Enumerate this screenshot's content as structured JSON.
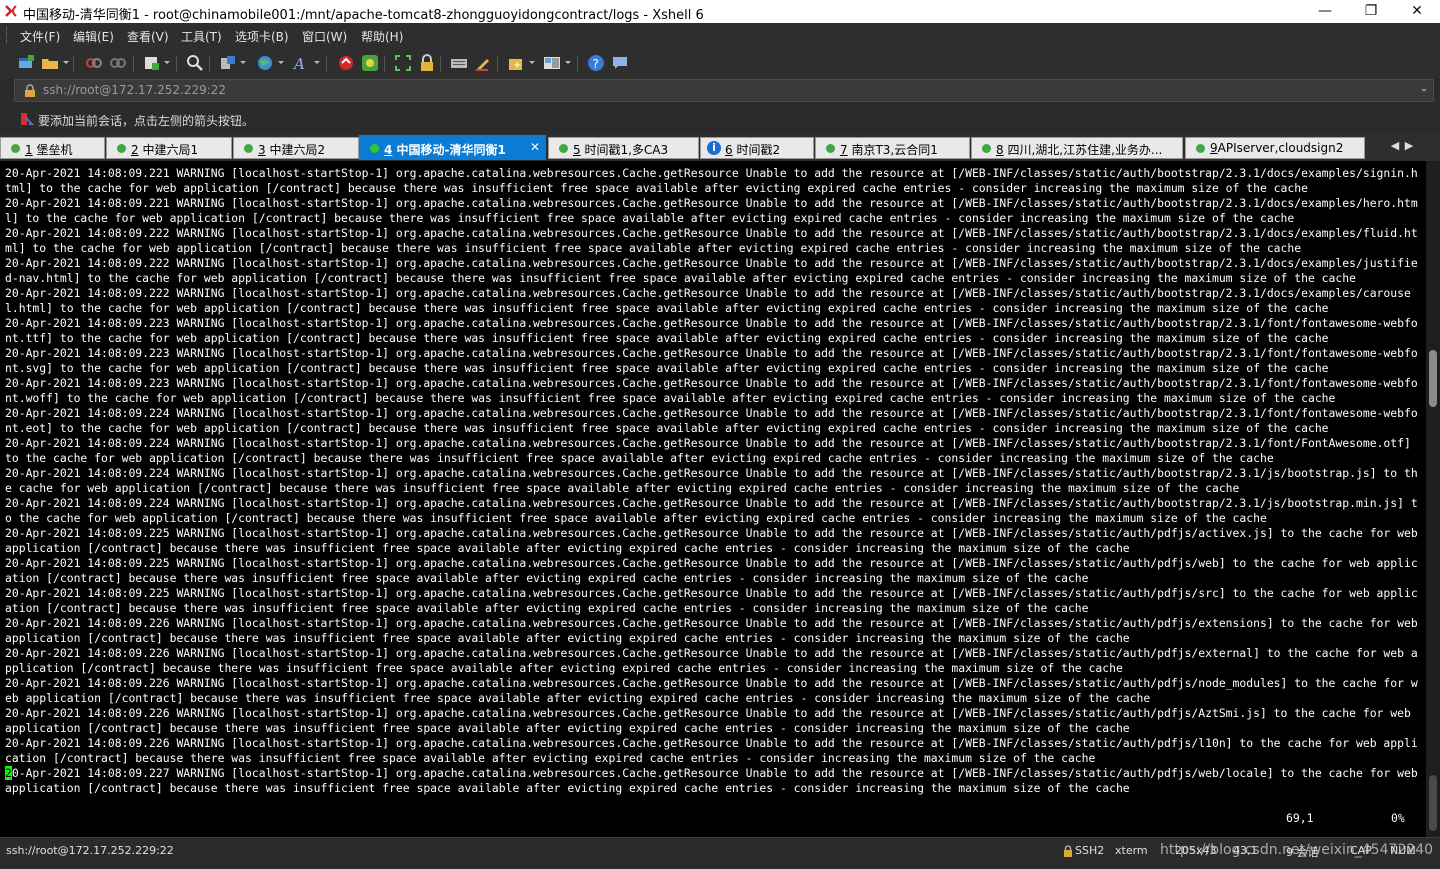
{
  "window": {
    "title": "中国移动-清华同衡1 - root@chinamobile001:/mnt/apache-tomcat8-zhongguoyidongcontract/logs - Xshell 6",
    "minimize": "—",
    "maximize": "❐",
    "close": "✕"
  },
  "menu": [
    "文件(F)",
    "编辑(E)",
    "查看(V)",
    "工具(T)",
    "选项卡(B)",
    "窗口(W)",
    "帮助(H)"
  ],
  "address": {
    "value": "ssh://root@172.17.252.229:22"
  },
  "hint": {
    "text": "要添加当前会话，点击左侧的箭头按钮。"
  },
  "tabs": [
    {
      "num": "1",
      "name": "堡垒机",
      "status": "connected"
    },
    {
      "num": "2",
      "name": "中建六局1",
      "status": "connected"
    },
    {
      "num": "3",
      "name": "中建六局2",
      "status": "connected"
    },
    {
      "num": "4",
      "name": "中国移动-清华同衡1",
      "status": "connected",
      "active": true,
      "close": "✕"
    },
    {
      "num": "5",
      "name": "时间戳1,多CA3",
      "status": "connected"
    },
    {
      "num": "6",
      "name": "时间戳2",
      "status": "info",
      "badge": "i"
    },
    {
      "num": "7",
      "name": "南京T3,云合同1",
      "status": "connected"
    },
    {
      "num": "8",
      "name": "四川,湖北,江苏住建,业务办...",
      "status": "connected"
    },
    {
      "num": "9",
      "name": "APIserver,cloudsign2",
      "status": "connected"
    }
  ],
  "tab_nav": {
    "prev": "◀",
    "next": "▶"
  },
  "terminal": {
    "lines": [
      "20-Apr-2021 14:08:09.221 WARNING [localhost-startStop-1] org.apache.catalina.webresources.Cache.getResource Unable to add the resource at [/WEB-INF/classes/static/auth/bootstrap/2.3.1/docs/examples/signin.html] to the cache for web application [/contract] because there was insufficient free space available after evicting expired cache entries - consider increasing the maximum size of the cache",
      "20-Apr-2021 14:08:09.221 WARNING [localhost-startStop-1] org.apache.catalina.webresources.Cache.getResource Unable to add the resource at [/WEB-INF/classes/static/auth/bootstrap/2.3.1/docs/examples/hero.html] to the cache for web application [/contract] because there was insufficient free space available after evicting expired cache entries - consider increasing the maximum size of the cache",
      "20-Apr-2021 14:08:09.222 WARNING [localhost-startStop-1] org.apache.catalina.webresources.Cache.getResource Unable to add the resource at [/WEB-INF/classes/static/auth/bootstrap/2.3.1/docs/examples/fluid.html] to the cache for web application [/contract] because there was insufficient free space available after evicting expired cache entries - consider increasing the maximum size of the cache",
      "20-Apr-2021 14:08:09.222 WARNING [localhost-startStop-1] org.apache.catalina.webresources.Cache.getResource Unable to add the resource at [/WEB-INF/classes/static/auth/bootstrap/2.3.1/docs/examples/justified-nav.html] to the cache for web application [/contract] because there was insufficient free space available after evicting expired cache entries - consider increasing the maximum size of the cache",
      "20-Apr-2021 14:08:09.222 WARNING [localhost-startStop-1] org.apache.catalina.webresources.Cache.getResource Unable to add the resource at [/WEB-INF/classes/static/auth/bootstrap/2.3.1/docs/examples/carousel.html] to the cache for web application [/contract] because there was insufficient free space available after evicting expired cache entries - consider increasing the maximum size of the cache",
      "20-Apr-2021 14:08:09.223 WARNING [localhost-startStop-1] org.apache.catalina.webresources.Cache.getResource Unable to add the resource at [/WEB-INF/classes/static/auth/bootstrap/2.3.1/font/fontawesome-webfont.ttf] to the cache for web application [/contract] because there was insufficient free space available after evicting expired cache entries - consider increasing the maximum size of the cache",
      "20-Apr-2021 14:08:09.223 WARNING [localhost-startStop-1] org.apache.catalina.webresources.Cache.getResource Unable to add the resource at [/WEB-INF/classes/static/auth/bootstrap/2.3.1/font/fontawesome-webfont.svg] to the cache for web application [/contract] because there was insufficient free space available after evicting expired cache entries - consider increasing the maximum size of the cache",
      "20-Apr-2021 14:08:09.223 WARNING [localhost-startStop-1] org.apache.catalina.webresources.Cache.getResource Unable to add the resource at [/WEB-INF/classes/static/auth/bootstrap/2.3.1/font/fontawesome-webfont.woff] to the cache for web application [/contract] because there was insufficient free space available after evicting expired cache entries - consider increasing the maximum size of the cache",
      "20-Apr-2021 14:08:09.224 WARNING [localhost-startStop-1] org.apache.catalina.webresources.Cache.getResource Unable to add the resource at [/WEB-INF/classes/static/auth/bootstrap/2.3.1/font/fontawesome-webfont.eot] to the cache for web application [/contract] because there was insufficient free space available after evicting expired cache entries - consider increasing the maximum size of the cache",
      "20-Apr-2021 14:08:09.224 WARNING [localhost-startStop-1] org.apache.catalina.webresources.Cache.getResource Unable to add the resource at [/WEB-INF/classes/static/auth/bootstrap/2.3.1/font/FontAwesome.otf] to the cache for web application [/contract] because there was insufficient free space available after evicting expired cache entries - consider increasing the maximum size of the cache",
      "20-Apr-2021 14:08:09.224 WARNING [localhost-startStop-1] org.apache.catalina.webresources.Cache.getResource Unable to add the resource at [/WEB-INF/classes/static/auth/bootstrap/2.3.1/js/bootstrap.js] to the cache for web application [/contract] because there was insufficient free space available after evicting expired cache entries - consider increasing the maximum size of the cache",
      "20-Apr-2021 14:08:09.224 WARNING [localhost-startStop-1] org.apache.catalina.webresources.Cache.getResource Unable to add the resource at [/WEB-INF/classes/static/auth/bootstrap/2.3.1/js/bootstrap.min.js] to the cache for web application [/contract] because there was insufficient free space available after evicting expired cache entries - consider increasing the maximum size of the cache",
      "20-Apr-2021 14:08:09.225 WARNING [localhost-startStop-1] org.apache.catalina.webresources.Cache.getResource Unable to add the resource at [/WEB-INF/classes/static/auth/pdfjs/activex.js] to the cache for web application [/contract] because there was insufficient free space available after evicting expired cache entries - consider increasing the maximum size of the cache",
      "20-Apr-2021 14:08:09.225 WARNING [localhost-startStop-1] org.apache.catalina.webresources.Cache.getResource Unable to add the resource at [/WEB-INF/classes/static/auth/pdfjs/web] to the cache for web application [/contract] because there was insufficient free space available after evicting expired cache entries - consider increasing the maximum size of the cache",
      "20-Apr-2021 14:08:09.225 WARNING [localhost-startStop-1] org.apache.catalina.webresources.Cache.getResource Unable to add the resource at [/WEB-INF/classes/static/auth/pdfjs/src] to the cache for web application [/contract] because there was insufficient free space available after evicting expired cache entries - consider increasing the maximum size of the cache",
      "20-Apr-2021 14:08:09.226 WARNING [localhost-startStop-1] org.apache.catalina.webresources.Cache.getResource Unable to add the resource at [/WEB-INF/classes/static/auth/pdfjs/extensions] to the cache for web application [/contract] because there was insufficient free space available after evicting expired cache entries - consider increasing the maximum size of the cache",
      "20-Apr-2021 14:08:09.226 WARNING [localhost-startStop-1] org.apache.catalina.webresources.Cache.getResource Unable to add the resource at [/WEB-INF/classes/static/auth/pdfjs/external] to the cache for web application [/contract] because there was insufficient free space available after evicting expired cache entries - consider increasing the maximum size of the cache",
      "20-Apr-2021 14:08:09.226 WARNING [localhost-startStop-1] org.apache.catalina.webresources.Cache.getResource Unable to add the resource at [/WEB-INF/classes/static/auth/pdfjs/node_modules] to the cache for web application [/contract] because there was insufficient free space available after evicting expired cache entries - consider increasing the maximum size of the cache",
      "20-Apr-2021 14:08:09.226 WARNING [localhost-startStop-1] org.apache.catalina.webresources.Cache.getResource Unable to add the resource at [/WEB-INF/classes/static/auth/pdfjs/AztSmi.js] to the cache for web application [/contract] because there was insufficient free space available after evicting expired cache entries - consider increasing the maximum size of the cache",
      "20-Apr-2021 14:08:09.226 WARNING [localhost-startStop-1] org.apache.catalina.webresources.Cache.getResource Unable to add the resource at [/WEB-INF/classes/static/auth/pdfjs/l10n] to the cache for web application [/contract] because there was insufficient free space available after evicting expired cache entries - consider increasing the maximum size of the cache"
    ],
    "cursor_char": "2",
    "last_line_rest": "0-Apr-2021 14:08:09.227 WARNING [localhost-startStop-1] org.apache.catalina.webresources.Cache.getResource Unable to add the resource at [/WEB-INF/classes/static/auth/pdfjs/web/locale] to the cache for web application [/contract] because there was insufficient free space available after evicting expired cache entries - consider increasing the maximum size of the cache",
    "position": "69,1",
    "percent": "0%"
  },
  "status": {
    "address": "ssh://root@172.17.252.229:22",
    "protocol": "SSH2",
    "term": "xterm",
    "size": "205x43",
    "cursor": "43,1",
    "sessions": "9 会话",
    "caps": "CAP",
    "num": "NUM",
    "watermark": "https://blog.csdn.net/weixin_45472240"
  },
  "colors": {
    "terminal_bg": "#000000",
    "terminal_fg": "#ffffff",
    "cursor": "#00ff00",
    "active_tab": "#0b7bd4",
    "chrome": "#2e2e2e"
  }
}
